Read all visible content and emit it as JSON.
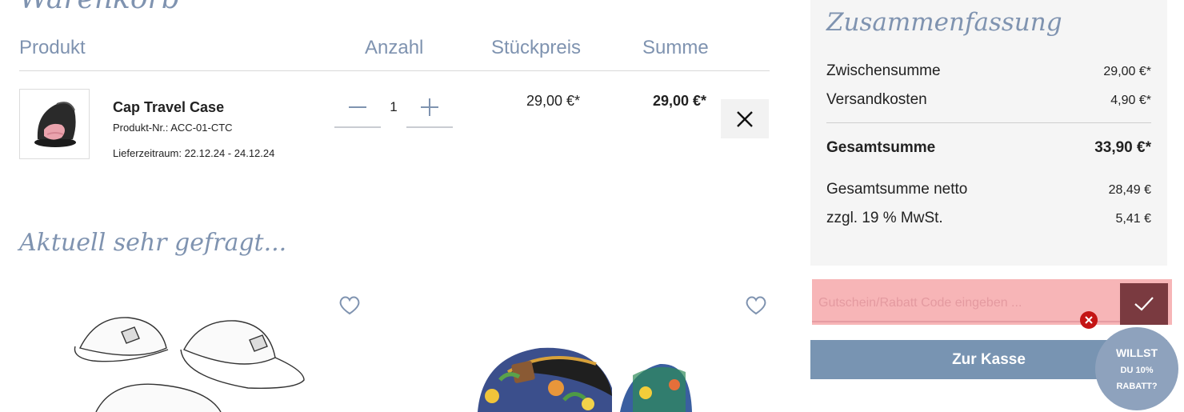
{
  "cart": {
    "section_title": "Warenkorb",
    "headers": {
      "product": "Produkt",
      "quantity": "Anzahl",
      "unit_price": "Stückpreis",
      "total": "Summe"
    },
    "item": {
      "name": "Cap Travel Case",
      "sku": "Produkt-Nr.: ACC-01-CTC",
      "delivery": "Lieferzeitraum: 22.12.24 - 24.12.24",
      "quantity": "1",
      "unit_price": "29,00 €*",
      "total": "29,00 €*"
    }
  },
  "recommendations": {
    "title": "Aktuell sehr gefragt...",
    "items": [
      {
        "image": "cap-line-drawing"
      },
      {
        "image": "floral-caps-photo"
      }
    ]
  },
  "summary": {
    "title": "Zusammenfassung",
    "rows": {
      "subtotal": {
        "label": "Zwischensumme",
        "value": "29,00 €*"
      },
      "shipping": {
        "label": "Versandkosten",
        "value": "4,90 €*"
      },
      "grand_total": {
        "label": "Gesamtsumme",
        "value": "33,90 €*"
      },
      "net_total": {
        "label": "Gesamtsumme netto",
        "value": "28,49 €"
      },
      "vat": {
        "label": "zzgl. 19 % MwSt.",
        "value": "5,41 €"
      }
    }
  },
  "coupon": {
    "placeholder": "Gutschein/Rabatt Code eingeben ..."
  },
  "checkout": {
    "label": "Zur Kasse"
  },
  "promo": {
    "line1": "WILLST",
    "line2": "DU 10%",
    "line3": "RABATT?"
  },
  "colors": {
    "accent": "#7894b2",
    "heading": "#7f93b0",
    "summary_bg": "#f5f5f5",
    "coupon_error_bg": "#f7b5b7",
    "coupon_submit": "#7a3a40",
    "error_icon": "#c41515"
  },
  "icons": [
    "minus-icon",
    "plus-icon",
    "close-icon",
    "heart-icon",
    "check-icon",
    "error-icon"
  ]
}
